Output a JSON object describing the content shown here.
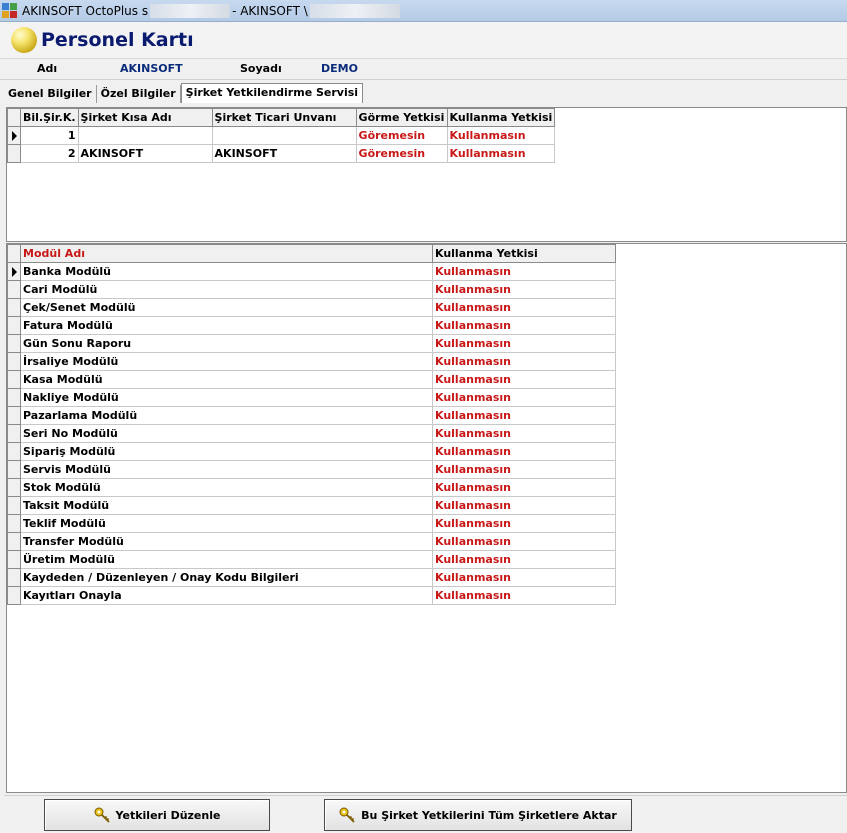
{
  "window": {
    "title_part1": "AKINSOFT OctoPlus s",
    "title_part2": "- AKINSOFT \\"
  },
  "header": {
    "title": "Personel Kartı"
  },
  "info": {
    "name_label": "Adı",
    "name_value": "AKINSOFT",
    "surname_label": "Soyadı",
    "surname_value": "DEMO"
  },
  "tabs": [
    {
      "label": "Genel Bilgiler"
    },
    {
      "label": "Özel Bilgiler"
    },
    {
      "label": "Şirket Yetkilendirme Servisi",
      "active": true
    }
  ],
  "companies": {
    "columns": [
      "Bil.Şir.K.",
      "Şirket Kısa Adı",
      "Şirket Ticari Unvanı",
      "Görme Yetkisi",
      "Kullanma Yetkisi"
    ],
    "rows": [
      {
        "code": "1",
        "short": "",
        "title": "",
        "view": "Göremesin",
        "use": "Kullanmasın"
      },
      {
        "code": "2",
        "short": "AKINSOFT",
        "title": "AKINSOFT",
        "view": "Göremesin",
        "use": "Kullanmasın"
      }
    ]
  },
  "modules": {
    "columns": [
      "Modül Adı",
      "Kullanma Yetkisi"
    ],
    "rows": [
      {
        "name": "Banka Modülü",
        "perm": "Kullanmasın"
      },
      {
        "name": "Cari Modülü",
        "perm": "Kullanmasın"
      },
      {
        "name": "Çek/Senet Modülü",
        "perm": "Kullanmasın"
      },
      {
        "name": "Fatura Modülü",
        "perm": "Kullanmasın"
      },
      {
        "name": "Gün Sonu Raporu",
        "perm": "Kullanmasın"
      },
      {
        "name": "İrsaliye Modülü",
        "perm": "Kullanmasın"
      },
      {
        "name": "Kasa Modülü",
        "perm": "Kullanmasın"
      },
      {
        "name": "Nakliye Modülü",
        "perm": "Kullanmasın"
      },
      {
        "name": "Pazarlama Modülü",
        "perm": "Kullanmasın"
      },
      {
        "name": "Seri No Modülü",
        "perm": "Kullanmasın"
      },
      {
        "name": "Sipariş Modülü",
        "perm": "Kullanmasın"
      },
      {
        "name": "Servis Modülü",
        "perm": "Kullanmasın"
      },
      {
        "name": "Stok Modülü",
        "perm": "Kullanmasın"
      },
      {
        "name": "Taksit Modülü",
        "perm": "Kullanmasın"
      },
      {
        "name": "Teklif Modülü",
        "perm": "Kullanmasın"
      },
      {
        "name": "Transfer Modülü",
        "perm": "Kullanmasın"
      },
      {
        "name": "Üretim Modülü",
        "perm": "Kullanmasın"
      },
      {
        "name": "Kaydeden / Düzenleyen / Onay Kodu Bilgileri",
        "perm": "Kullanmasın"
      },
      {
        "name": "Kayıtları Onayla",
        "perm": "Kullanmasın"
      }
    ]
  },
  "buttons": {
    "edit": "Yetkileri Düzenle",
    "transfer": "Bu Şirket Yetkilerini Tüm Şirketlere Aktar"
  },
  "colors": {
    "accent_red": "#c81818",
    "title_blue": "#0a1a6e",
    "value_blue": "#0a2b7a"
  }
}
